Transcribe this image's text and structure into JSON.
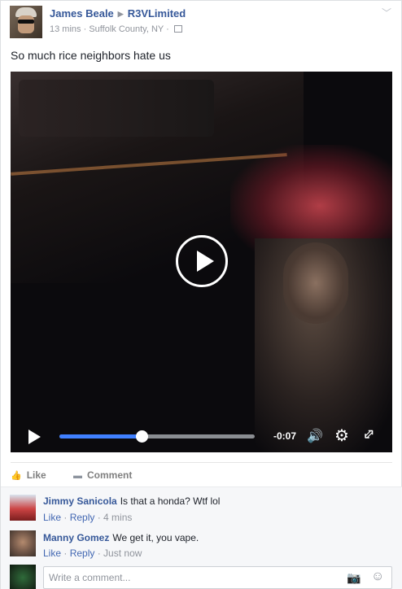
{
  "post": {
    "author": "James Beale",
    "group": "R3VLimited",
    "time": "13 mins",
    "location": "Suffolk County, NY",
    "separator": "·",
    "text": "So much rice neighbors hate us"
  },
  "video": {
    "remaining_time": "-0:07",
    "progress_percent": 42,
    "icons": [
      "play-icon",
      "volume-icon",
      "settings-gear-icon",
      "fullscreen-icon"
    ]
  },
  "actions": {
    "like_label": "Like",
    "comment_label": "Comment"
  },
  "comments": [
    {
      "name": "Jimmy Sanicola",
      "text": "Is that a honda? Wtf lol",
      "like": "Like",
      "reply": "Reply",
      "time": "4 mins"
    },
    {
      "name": "Manny Gomez",
      "text": "We get it, you vape.",
      "like": "Like",
      "reply": "Reply",
      "time": "Just now"
    }
  ],
  "composer": {
    "placeholder": "Write a comment..."
  },
  "colors": {
    "link": "#365899",
    "progress": "#4080ff",
    "meta": "#90949c"
  }
}
